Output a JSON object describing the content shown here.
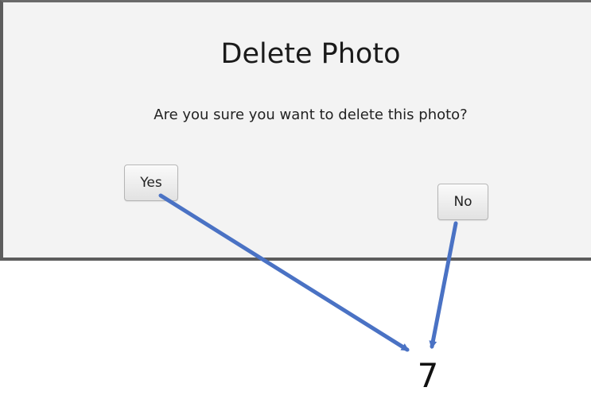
{
  "dialog": {
    "title": "Delete Photo",
    "message": "Are you sure you want to delete this photo?",
    "yes_label": "Yes",
    "no_label": "No"
  },
  "annotation": {
    "number": "7",
    "arrow_color": "#4a72c4"
  }
}
